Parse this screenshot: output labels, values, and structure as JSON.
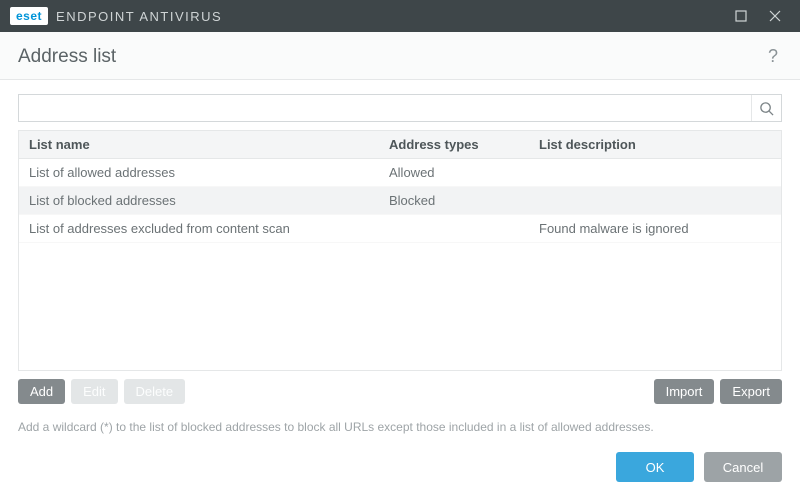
{
  "titlebar": {
    "brand": "eset",
    "product": "ENDPOINT ANTIVIRUS"
  },
  "header": {
    "title": "Address list"
  },
  "search": {
    "value": "",
    "placeholder": ""
  },
  "table": {
    "columns": {
      "name": "List name",
      "type": "Address types",
      "desc": "List description"
    },
    "rows": [
      {
        "name": "List of allowed addresses",
        "type": "Allowed",
        "desc": "",
        "selected": false
      },
      {
        "name": "List of blocked addresses",
        "type": "Blocked",
        "desc": "",
        "selected": true
      },
      {
        "name": "List of addresses excluded from content scan",
        "type": "",
        "desc": "Found malware is ignored",
        "selected": false
      }
    ]
  },
  "actions": {
    "add": "Add",
    "edit": "Edit",
    "delete": "Delete",
    "import": "Import",
    "export": "Export"
  },
  "hint": "Add a wildcard (*) to the list of blocked addresses to block all URLs except those included in a list of allowed addresses.",
  "footer": {
    "ok": "OK",
    "cancel": "Cancel"
  }
}
